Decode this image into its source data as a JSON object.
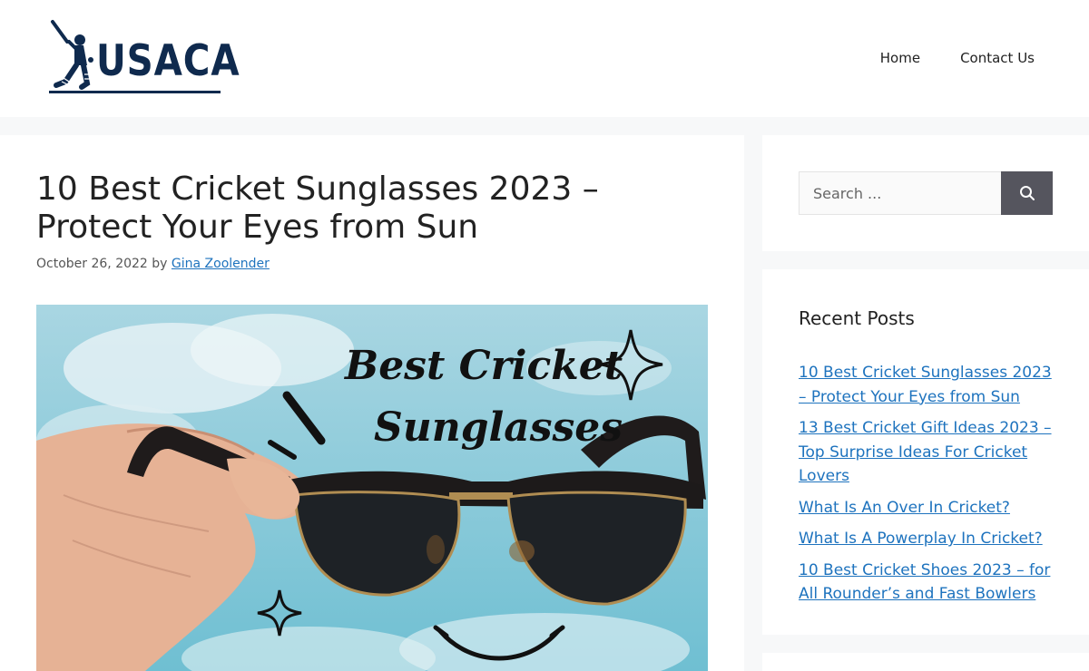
{
  "header": {
    "logo_text": "USACA",
    "nav": [
      {
        "label": "Home"
      },
      {
        "label": "Contact Us"
      }
    ]
  },
  "article": {
    "title": "10 Best Cricket Sunglasses 2023 – Protect Your Eyes from Sun",
    "date": "October 26, 2022",
    "by": "by",
    "author": "Gina Zoolender",
    "image_text_line1": "Best Cricket",
    "image_text_line2": "Sunglasses"
  },
  "sidebar": {
    "search": {
      "placeholder": "Search ...",
      "button_icon": "search-icon"
    },
    "recent_posts": {
      "title": "Recent Posts",
      "items": [
        {
          "label": "10 Best Cricket Sunglasses 2023 – Protect Your Eyes from Sun"
        },
        {
          "label": "13 Best Cricket Gift Ideas 2023 – Top Surprise Ideas For Cricket Lovers"
        },
        {
          "label": "What Is An Over In Cricket?"
        },
        {
          "label": "What Is A Powerplay In Cricket?"
        },
        {
          "label": "10 Best Cricket Shoes 2023 – for All Rounder’s and Fast Bowlers"
        }
      ]
    }
  },
  "colors": {
    "brand": "#0f2a4e",
    "link": "#1e73be",
    "search_button": "#55555e",
    "page_bg": "#f7f8f9"
  }
}
